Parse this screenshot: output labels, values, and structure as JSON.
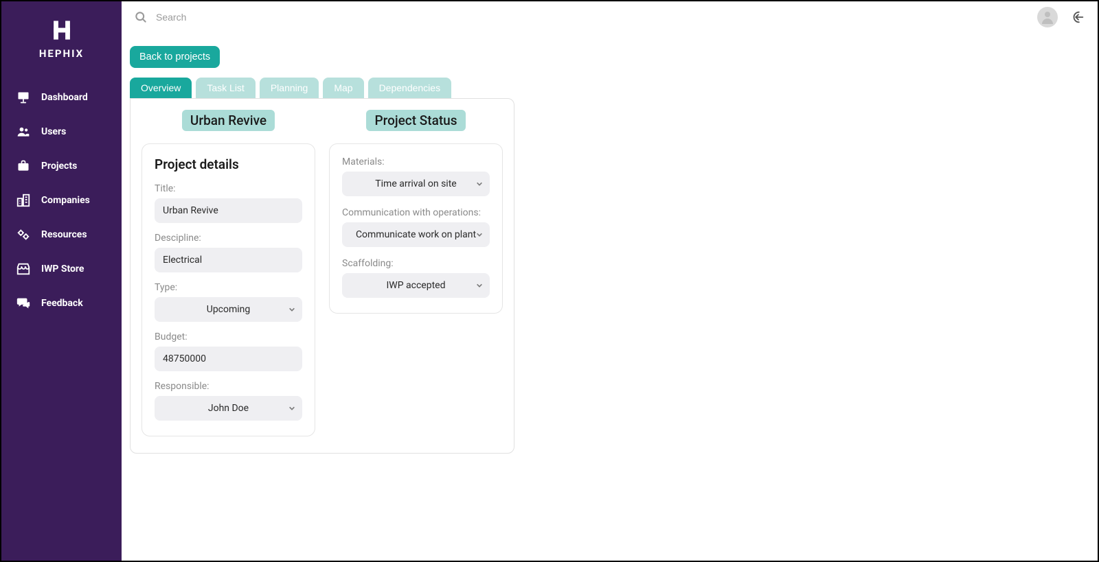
{
  "brand": {
    "text": "HEPHIX"
  },
  "search": {
    "placeholder": "Search"
  },
  "sidebar": {
    "items": [
      {
        "label": "Dashboard"
      },
      {
        "label": "Users"
      },
      {
        "label": "Projects"
      },
      {
        "label": "Companies"
      },
      {
        "label": "Resources"
      },
      {
        "label": "IWP Store"
      },
      {
        "label": "Feedback"
      }
    ]
  },
  "back_button_label": "Back to projects",
  "tabs": [
    {
      "label": "Overview",
      "active": true
    },
    {
      "label": "Task List",
      "active": false
    },
    {
      "label": "Planning",
      "active": false
    },
    {
      "label": "Map",
      "active": false
    },
    {
      "label": "Dependencies",
      "active": false
    }
  ],
  "project_title_pill": "Urban Revive",
  "project_status_pill": "Project Status",
  "details": {
    "heading": "Project details",
    "title_label": "Title:",
    "title_value": "Urban Revive",
    "discipline_label": "Descipline:",
    "discipline_value": "Electrical",
    "type_label": "Type:",
    "type_value": "Upcoming",
    "budget_label": "Budget:",
    "budget_value": "48750000",
    "responsible_label": "Responsible:",
    "responsible_value": "John Doe"
  },
  "status": {
    "materials_label": "Materials:",
    "materials_value": "Time arrival on site",
    "communication_label": "Communication with operations:",
    "communication_value": "Communicate work on plant",
    "scaffolding_label": "Scaffolding:",
    "scaffolding_value": "IWP accepted"
  }
}
